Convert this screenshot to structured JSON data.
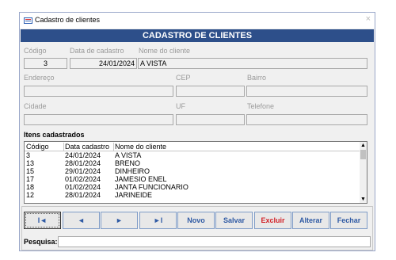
{
  "window": {
    "title": "Cadastro de clientes",
    "close_glyph": "×",
    "icon": "form-icon"
  },
  "header": {
    "title": "CADASTRO DE CLIENTES"
  },
  "form": {
    "codigo_label": "Código",
    "codigo_value": "3",
    "data_label": "Data de cadastro",
    "data_value": "24/01/2024",
    "nome_label": "Nome do cliente",
    "nome_value": "A VISTA",
    "endereco_label": "Endereço",
    "endereco_value": "",
    "cep_label": "CEP",
    "cep_value": "",
    "bairro_label": "Bairro",
    "bairro_value": "",
    "cidade_label": "Cidade",
    "cidade_value": "",
    "uf_label": "UF",
    "uf_value": "",
    "telefone_label": "Telefone",
    "telefone_value": ""
  },
  "list": {
    "title": "Itens cadastrados",
    "columns": [
      "Código",
      "Data cadastro",
      "Nome do cliente"
    ],
    "rows": [
      [
        "3",
        "24/01/2024",
        "A VISTA"
      ],
      [
        "13",
        "28/01/2024",
        "BRENO"
      ],
      [
        "15",
        "29/01/2024",
        "DINHEIRO"
      ],
      [
        "17",
        "01/02/2024",
        "JAMESIO ENEL"
      ],
      [
        "18",
        "01/02/2024",
        "JANTA FUNCIONARIO"
      ],
      [
        "12",
        "28/01/2024",
        "JARINEIDE"
      ]
    ],
    "scroll_up": "▲",
    "scroll_down": "▼"
  },
  "buttons": {
    "first": "I◄",
    "prev": "◄",
    "next": "►",
    "last": "►I",
    "novo": "Novo",
    "salvar": "Salvar",
    "excluir": "Excluir",
    "alterar": "Alterar",
    "fechar": "Fechar"
  },
  "search": {
    "label": "Pesquisa:",
    "value": ""
  },
  "colors": {
    "header_bg": "#2d4f8a",
    "button_text": "#2f5aa4",
    "delete_text": "#d2232a"
  }
}
